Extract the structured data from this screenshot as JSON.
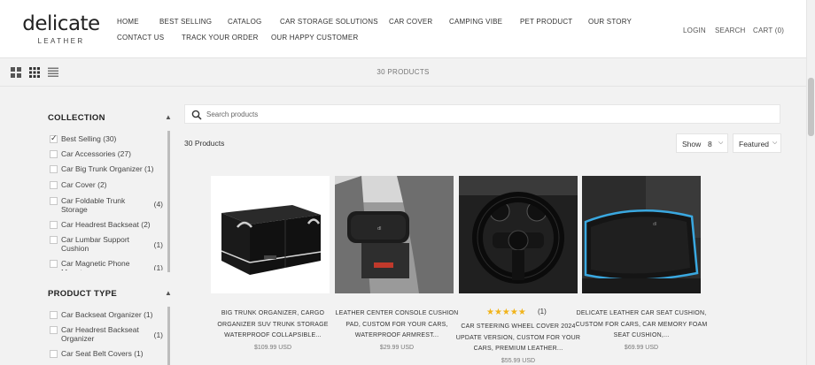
{
  "brand": {
    "logo_main": "delicate",
    "logo_sub": "LEATHER"
  },
  "nav": {
    "row1": [
      "HOME",
      "BEST SELLING",
      "CATALOG",
      "CAR STORAGE SOLUTIONS",
      "CAR COVER",
      "CAMPING VIBE",
      "PET PRODUCT",
      "OUR STORY"
    ],
    "row2": [
      "CONTACT US",
      "TRACK YOUR ORDER",
      "OUR HAPPY CUSTOMER"
    ],
    "right": {
      "login": "LOGIN",
      "search": "SEARCH",
      "cart": "CART (0)"
    }
  },
  "toolbar": {
    "center_count": "30 PRODUCTS",
    "view_icons": [
      "grid-2-icon",
      "grid-3-icon",
      "list-icon"
    ]
  },
  "sidebar": {
    "collection": {
      "title": "COLLECTION",
      "items": [
        {
          "label": "Best Selling",
          "count": "(30)",
          "checked": true
        },
        {
          "label": "Car Accessories",
          "count": "(27)",
          "checked": false
        },
        {
          "label": "Car Big Trunk Organizer",
          "count": "(1)",
          "checked": false
        },
        {
          "label": "Car Cover",
          "count": "(2)",
          "checked": false
        },
        {
          "label": "Car Foldable Trunk Storage",
          "count": "(4)",
          "checked": false
        },
        {
          "label": "Car Headrest Backseat",
          "count": "(2)",
          "checked": false
        },
        {
          "label": "Car Lumbar Support Cushion",
          "count": "(1)",
          "checked": false
        },
        {
          "label": "Car Magnetic Phone Mount",
          "count": "(1)",
          "checked": false
        }
      ]
    },
    "product_type": {
      "title": "PRODUCT TYPE",
      "items": [
        {
          "label": "Car Backseat Organizer",
          "count": "(1)",
          "checked": false
        },
        {
          "label": "Car Headrest Backseat Organizer",
          "count": "(1)",
          "checked": false
        },
        {
          "label": "Car Seat Belt Covers",
          "count": "(1)",
          "checked": false
        }
      ]
    }
  },
  "search": {
    "placeholder": "Search products"
  },
  "results": {
    "count_label": "30 Products",
    "show_label": "Show",
    "show_value": "8",
    "sort_value": "Featured"
  },
  "products": [
    {
      "title": "BIG TRUNK ORGANIZER, CARGO ORGANIZER SUV TRUNK STORAGE WATERPROOF COLLAPSIBLE...",
      "price": "$109.99 USD"
    },
    {
      "title": "LEATHER CENTER CONSOLE CUSHION PAD, CUSTOM FOR YOUR CARS, WATERPROOF ARMREST...",
      "price": "$29.99 USD"
    },
    {
      "title": "CAR STEERING WHEEL COVER 2024 UPDATE VERSION, CUSTOM FOR YOUR CARS, PREMIUM LEATHER...",
      "price": "$55.99 USD",
      "rating": 5,
      "reviews": "(1)"
    },
    {
      "title": "DELICATE LEATHER CAR SEAT CUSHION, CUSTOM FOR CARS, CAR MEMORY FOAM SEAT CUSHION,...",
      "price": "$69.99 USD"
    }
  ],
  "colors": {
    "accent_star": "#f1b41b",
    "page_bg": "#f2f2f2",
    "header_bg": "#ffffff"
  }
}
